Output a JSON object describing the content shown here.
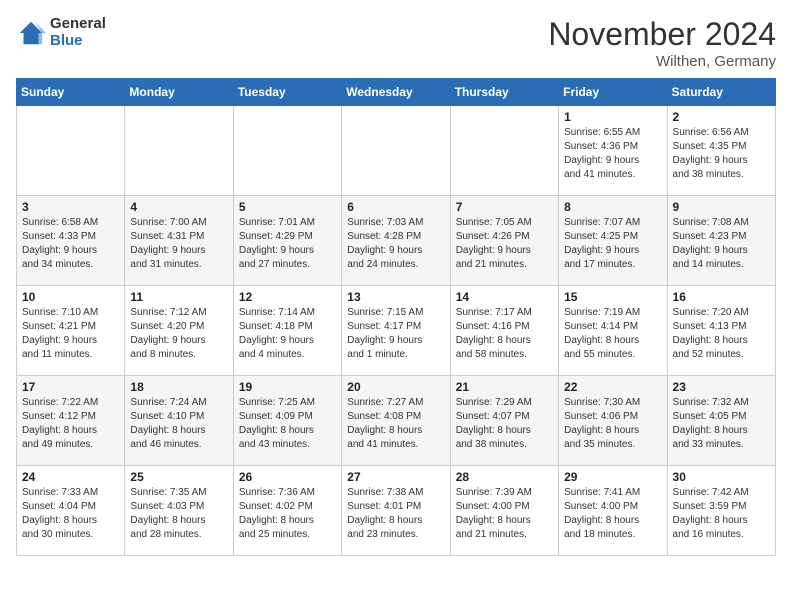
{
  "logo": {
    "general": "General",
    "blue": "Blue"
  },
  "title": "November 2024",
  "subtitle": "Wilthen, Germany",
  "weekdays": [
    "Sunday",
    "Monday",
    "Tuesday",
    "Wednesday",
    "Thursday",
    "Friday",
    "Saturday"
  ],
  "weeks": [
    [
      {
        "day": "",
        "info": ""
      },
      {
        "day": "",
        "info": ""
      },
      {
        "day": "",
        "info": ""
      },
      {
        "day": "",
        "info": ""
      },
      {
        "day": "",
        "info": ""
      },
      {
        "day": "1",
        "info": "Sunrise: 6:55 AM\nSunset: 4:36 PM\nDaylight: 9 hours\nand 41 minutes."
      },
      {
        "day": "2",
        "info": "Sunrise: 6:56 AM\nSunset: 4:35 PM\nDaylight: 9 hours\nand 38 minutes."
      }
    ],
    [
      {
        "day": "3",
        "info": "Sunrise: 6:58 AM\nSunset: 4:33 PM\nDaylight: 9 hours\nand 34 minutes."
      },
      {
        "day": "4",
        "info": "Sunrise: 7:00 AM\nSunset: 4:31 PM\nDaylight: 9 hours\nand 31 minutes."
      },
      {
        "day": "5",
        "info": "Sunrise: 7:01 AM\nSunset: 4:29 PM\nDaylight: 9 hours\nand 27 minutes."
      },
      {
        "day": "6",
        "info": "Sunrise: 7:03 AM\nSunset: 4:28 PM\nDaylight: 9 hours\nand 24 minutes."
      },
      {
        "day": "7",
        "info": "Sunrise: 7:05 AM\nSunset: 4:26 PM\nDaylight: 9 hours\nand 21 minutes."
      },
      {
        "day": "8",
        "info": "Sunrise: 7:07 AM\nSunset: 4:25 PM\nDaylight: 9 hours\nand 17 minutes."
      },
      {
        "day": "9",
        "info": "Sunrise: 7:08 AM\nSunset: 4:23 PM\nDaylight: 9 hours\nand 14 minutes."
      }
    ],
    [
      {
        "day": "10",
        "info": "Sunrise: 7:10 AM\nSunset: 4:21 PM\nDaylight: 9 hours\nand 11 minutes."
      },
      {
        "day": "11",
        "info": "Sunrise: 7:12 AM\nSunset: 4:20 PM\nDaylight: 9 hours\nand 8 minutes."
      },
      {
        "day": "12",
        "info": "Sunrise: 7:14 AM\nSunset: 4:18 PM\nDaylight: 9 hours\nand 4 minutes."
      },
      {
        "day": "13",
        "info": "Sunrise: 7:15 AM\nSunset: 4:17 PM\nDaylight: 9 hours\nand 1 minute."
      },
      {
        "day": "14",
        "info": "Sunrise: 7:17 AM\nSunset: 4:16 PM\nDaylight: 8 hours\nand 58 minutes."
      },
      {
        "day": "15",
        "info": "Sunrise: 7:19 AM\nSunset: 4:14 PM\nDaylight: 8 hours\nand 55 minutes."
      },
      {
        "day": "16",
        "info": "Sunrise: 7:20 AM\nSunset: 4:13 PM\nDaylight: 8 hours\nand 52 minutes."
      }
    ],
    [
      {
        "day": "17",
        "info": "Sunrise: 7:22 AM\nSunset: 4:12 PM\nDaylight: 8 hours\nand 49 minutes."
      },
      {
        "day": "18",
        "info": "Sunrise: 7:24 AM\nSunset: 4:10 PM\nDaylight: 8 hours\nand 46 minutes."
      },
      {
        "day": "19",
        "info": "Sunrise: 7:25 AM\nSunset: 4:09 PM\nDaylight: 8 hours\nand 43 minutes."
      },
      {
        "day": "20",
        "info": "Sunrise: 7:27 AM\nSunset: 4:08 PM\nDaylight: 8 hours\nand 41 minutes."
      },
      {
        "day": "21",
        "info": "Sunrise: 7:29 AM\nSunset: 4:07 PM\nDaylight: 8 hours\nand 38 minutes."
      },
      {
        "day": "22",
        "info": "Sunrise: 7:30 AM\nSunset: 4:06 PM\nDaylight: 8 hours\nand 35 minutes."
      },
      {
        "day": "23",
        "info": "Sunrise: 7:32 AM\nSunset: 4:05 PM\nDaylight: 8 hours\nand 33 minutes."
      }
    ],
    [
      {
        "day": "24",
        "info": "Sunrise: 7:33 AM\nSunset: 4:04 PM\nDaylight: 8 hours\nand 30 minutes."
      },
      {
        "day": "25",
        "info": "Sunrise: 7:35 AM\nSunset: 4:03 PM\nDaylight: 8 hours\nand 28 minutes."
      },
      {
        "day": "26",
        "info": "Sunrise: 7:36 AM\nSunset: 4:02 PM\nDaylight: 8 hours\nand 25 minutes."
      },
      {
        "day": "27",
        "info": "Sunrise: 7:38 AM\nSunset: 4:01 PM\nDaylight: 8 hours\nand 23 minutes."
      },
      {
        "day": "28",
        "info": "Sunrise: 7:39 AM\nSunset: 4:00 PM\nDaylight: 8 hours\nand 21 minutes."
      },
      {
        "day": "29",
        "info": "Sunrise: 7:41 AM\nSunset: 4:00 PM\nDaylight: 8 hours\nand 18 minutes."
      },
      {
        "day": "30",
        "info": "Sunrise: 7:42 AM\nSunset: 3:59 PM\nDaylight: 8 hours\nand 16 minutes."
      }
    ]
  ]
}
